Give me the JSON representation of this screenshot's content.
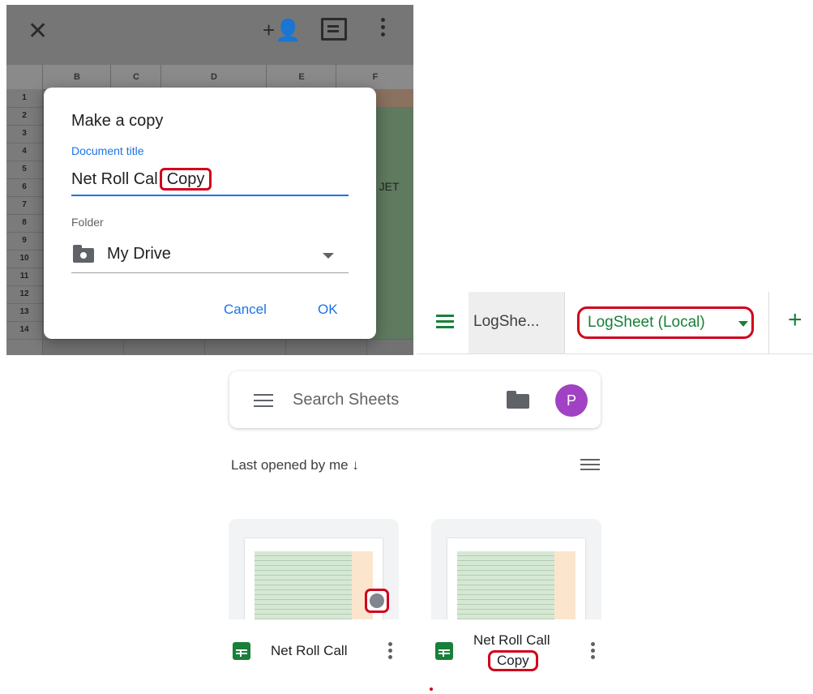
{
  "copy_dialog": {
    "title": "Make a copy",
    "document_title_label": "Document title",
    "title_value_part1": "Net Roll Cal",
    "title_value_part2": "Copy",
    "folder_label": "Folder",
    "folder_value": "My Drive",
    "cancel_label": "Cancel",
    "ok_label": "OK",
    "background_columns": [
      "B",
      "C",
      "D",
      "E",
      "F"
    ],
    "background_rows": [
      "1",
      "2",
      "3",
      "4",
      "5",
      "6",
      "7",
      "8",
      "9",
      "10",
      "11",
      "12",
      "13",
      "14"
    ],
    "background_cut_text": "e JET"
  },
  "sheet_tabs": {
    "tabs": [
      {
        "label": "LogShe..."
      },
      {
        "label": "LogSheet (Local)"
      }
    ],
    "add_label": "+"
  },
  "sheets_home": {
    "search_placeholder": "Search Sheets",
    "avatar_initial": "P",
    "sort_label": "Last opened by me",
    "sort_arrow": "↓",
    "files": [
      {
        "name": "Net Roll Call",
        "shared": true
      },
      {
        "name_line1": "Net Roll Call",
        "name_line2": "Copy",
        "shared": false
      }
    ]
  },
  "colors": {
    "accent_blue": "#1a73e8",
    "sheets_green": "#188038",
    "highlight_red": "#d0021b",
    "avatar_purple": "#a142c4"
  }
}
